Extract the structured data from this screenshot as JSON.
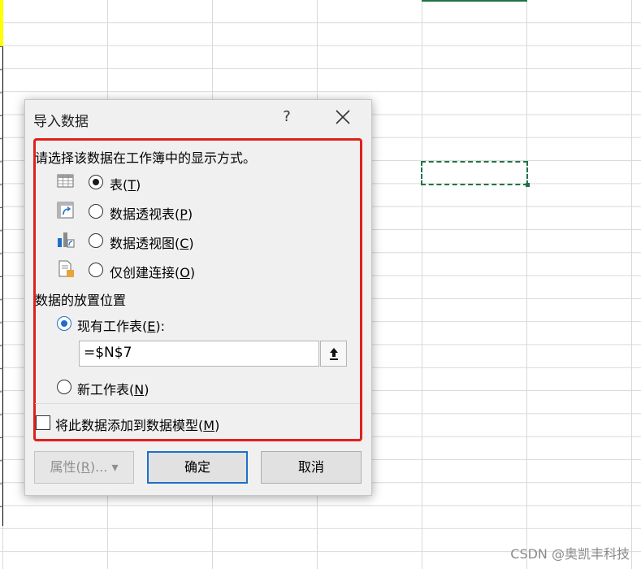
{
  "dialog": {
    "title": "导入数据",
    "help_label": "?",
    "prompt": "请选择该数据在工作簿中的显示方式。",
    "view_options": [
      {
        "label": "表(",
        "key": "T",
        "suffix": ")",
        "selected": true,
        "icon": "table-icon"
      },
      {
        "label": "数据透视表(",
        "key": "P",
        "suffix": ")",
        "selected": false,
        "icon": "pivot-table-icon"
      },
      {
        "label": "数据透视图(",
        "key": "C",
        "suffix": ")",
        "selected": false,
        "icon": "pivot-chart-icon"
      },
      {
        "label": "仅创建连接(",
        "key": "O",
        "suffix": ")",
        "selected": false,
        "icon": "connection-only-icon"
      }
    ],
    "placement_title": "数据的放置位置",
    "existing_sheet": {
      "label": "现有工作表(",
      "key": "E",
      "suffix": "):",
      "selected": true
    },
    "range_value": "=$N$7",
    "new_sheet": {
      "label": "新工作表(",
      "key": "N",
      "suffix": ")",
      "selected": false
    },
    "add_to_model": {
      "label": "将此数据添加到数据模型(",
      "key": "M",
      "suffix": ")",
      "checked": false
    },
    "buttons": {
      "properties": {
        "label": "属性(",
        "key": "R",
        "suffix": ")...",
        "dropdown": "▾"
      },
      "ok": "确定",
      "cancel": "取消"
    }
  },
  "watermark": "CSDN @奥凯丰科技",
  "colors": {
    "accent": "#1f6fc9",
    "highlight": "#e0201c",
    "excel_green": "#217346"
  }
}
